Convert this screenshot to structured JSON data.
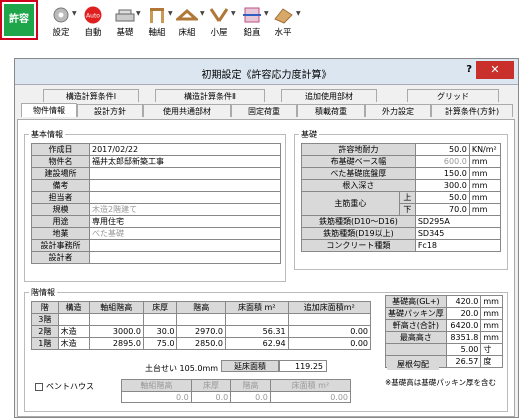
{
  "toolbar": {
    "items": [
      {
        "label": "許容",
        "icon": "kyoyo-icon"
      },
      {
        "label": "設定",
        "icon": "settings-icon"
      },
      {
        "label": "自動",
        "icon": "auto-icon"
      },
      {
        "label": "基礎",
        "icon": "foundation-icon"
      },
      {
        "label": "軸組",
        "icon": "frame-icon"
      },
      {
        "label": "床組",
        "icon": "floor-icon"
      },
      {
        "label": "小屋",
        "icon": "roof-icon"
      },
      {
        "label": "鉛直",
        "icon": "vertical-icon"
      },
      {
        "label": "水平",
        "icon": "horizontal-icon"
      }
    ],
    "auto_badge": "Auto",
    "accent_green": "#1fa64a",
    "accent_red": "#d0021b"
  },
  "dialog": {
    "title": "初期設定《許容応力度計算》",
    "help": "?",
    "close": "✕",
    "tabs_row1": [
      "構造計算条件Ⅰ",
      "構造計算条件Ⅱ",
      "追加使用部材",
      "グリッド"
    ],
    "tabs_row2": [
      "物件情報",
      "設計方針",
      "使用共通部材",
      "固定荷重",
      "積載荷重",
      "外力設定",
      "計算条件(方針)"
    ]
  },
  "basic": {
    "title": "基本情報",
    "rows": [
      {
        "label": "作成日",
        "value": "2017/02/22",
        "gray": false
      },
      {
        "label": "物件名",
        "value": "福井太郎邸新築工事",
        "gray": false
      },
      {
        "label": "建設場所",
        "value": "",
        "gray": false
      },
      {
        "label": "備考",
        "value": "",
        "gray": false
      },
      {
        "label": "担当者",
        "value": "",
        "gray": false
      },
      {
        "label": "規模",
        "value": "木造2階建て",
        "gray": true
      },
      {
        "label": "用途",
        "value": "専用住宅",
        "gray": false
      },
      {
        "label": "地業",
        "value": "べた基礎",
        "gray": true
      },
      {
        "label": "設計事務所",
        "value": "",
        "gray": false
      },
      {
        "label": "設計者",
        "value": "",
        "gray": false
      }
    ]
  },
  "foundation": {
    "title": "基礎",
    "rows": [
      {
        "label": "許容地耐力",
        "value": "50.0",
        "unit": "KN/m²",
        "gray": false
      },
      {
        "label": "布基礎ベース幅",
        "value": "600.0",
        "unit": "mm",
        "gray": true
      },
      {
        "label": "べた基礎底盤厚",
        "value": "150.0",
        "unit": "mm",
        "gray": false
      },
      {
        "label": "根入深さ",
        "value": "300.0",
        "unit": "mm",
        "gray": false
      }
    ],
    "center_label": "主筋重心",
    "upper_label": "上",
    "upper_value": "50.0",
    "lower_label": "下",
    "lower_value": "70.0",
    "mm": "mm",
    "rebar1_label": "鉄筋種類(D10～D16)",
    "rebar1_value": "SD295A",
    "rebar2_label": "鉄筋種類(D19以上)",
    "rebar2_value": "SD345",
    "concrete_label": "コンクリート種類",
    "concrete_value": "Fc18"
  },
  "floors": {
    "title": "階情報",
    "headers": [
      "階",
      "構造",
      "軸組階高",
      "床厚",
      "階高",
      "床面積 m²",
      "追加床面積m²"
    ],
    "rows": [
      {
        "floor": "3階",
        "struct": "",
        "axis": "",
        "thick": "",
        "height": "",
        "area": "",
        "extra": ""
      },
      {
        "floor": "2階",
        "struct": "木造",
        "axis": "3000.0",
        "thick": "30.0",
        "height": "2970.0",
        "area": "56.31",
        "extra": "0.00"
      },
      {
        "floor": "1階",
        "struct": "木造",
        "axis": "2895.0",
        "thick": "75.0",
        "height": "2850.0",
        "area": "62.94",
        "extra": "0.00"
      }
    ],
    "dodai_label": "土台せい 105.0mm",
    "nobe_label": "延床面積",
    "nobe_value": "119.25",
    "penthouse_label": "ペントハウス",
    "ph_headers": [
      "軸組階高",
      "床厚",
      "階高",
      "床面積 m²"
    ],
    "ph_values": [
      "0.0",
      "0.0",
      "0.0",
      "0.00"
    ]
  },
  "levels": {
    "rows": [
      {
        "label": "基礎高(GL+)",
        "value": "420.0",
        "unit": "mm"
      },
      {
        "label": "基礎パッキン厚",
        "value": "20.0",
        "unit": "mm"
      },
      {
        "label": "軒高さ(合計)",
        "value": "6420.0",
        "unit": "mm"
      },
      {
        "label": "最高高さ",
        "value": "8351.8",
        "unit": "mm"
      },
      {
        "label": "",
        "value": "5.00",
        "unit": "寸"
      }
    ],
    "slope_label": "屋根勾配",
    "slope_deg": "26.57",
    "deg_unit": "度",
    "note": "※基礎高は基礎パッキン厚を含む"
  }
}
